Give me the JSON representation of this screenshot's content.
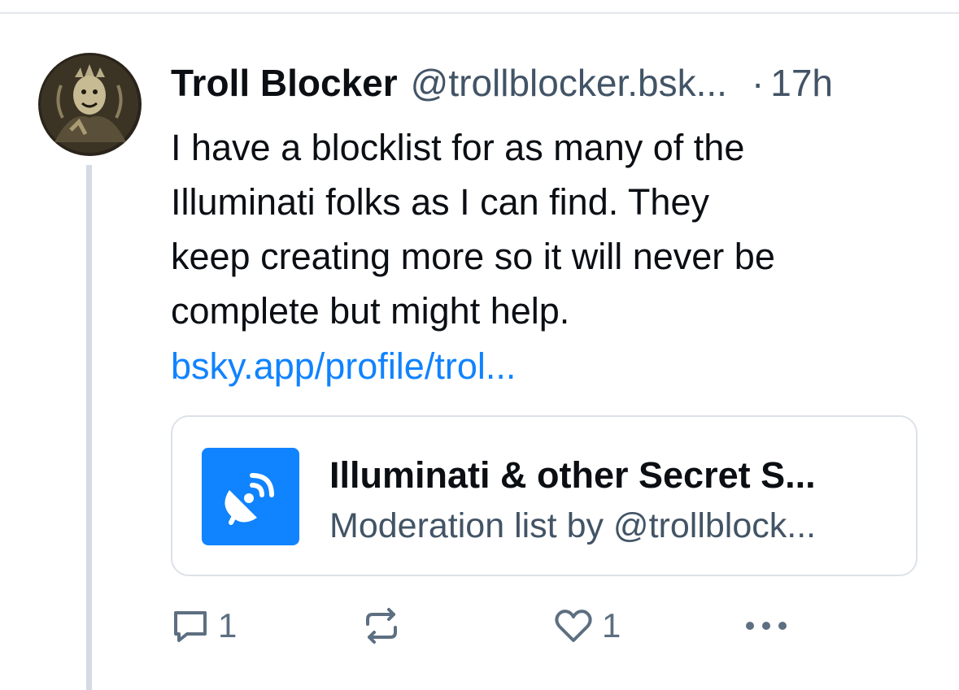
{
  "post": {
    "display_name": "Troll Blocker",
    "handle": "@trollblocker.bsk...",
    "dot": "·",
    "time": "17h",
    "text": "I have a blocklist for as many of the\nIlluminati folks as I can find. They\nkeep creating more so it will never be\ncomplete but might help.",
    "link": "bsky.app/profile/trol..."
  },
  "embed": {
    "title": "Illuminati & other Secret S...",
    "subtitle": "Moderation list by @trollblock...",
    "icon": "satellite-dish-icon",
    "icon_bg": "#1083fe"
  },
  "actions": {
    "reply_count": "1",
    "repost_count": "",
    "like_count": "1"
  },
  "colors": {
    "text": "#0b0f14",
    "secondary": "#425466",
    "link": "#1083fe",
    "divider": "#e3e7ec",
    "thread_line": "#d4dbe2"
  }
}
